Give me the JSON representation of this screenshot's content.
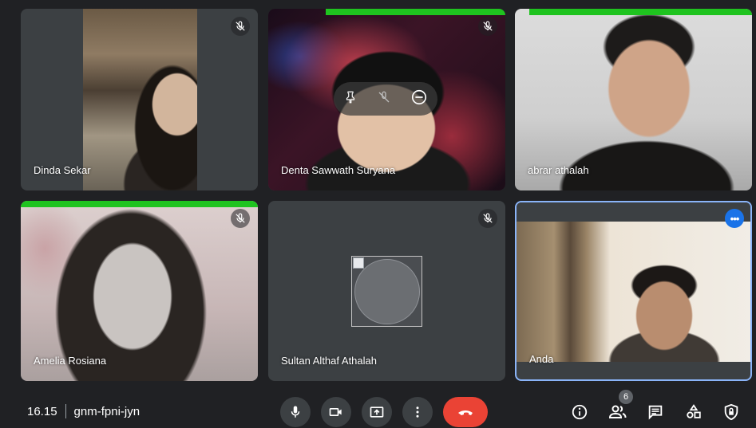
{
  "participants": {
    "dinda": {
      "name": "Dinda Sekar"
    },
    "denta": {
      "name": "Denta Sawwath Suryana"
    },
    "abrar": {
      "name": "abrar athalah"
    },
    "amelia": {
      "name": "Amelia Rosiana"
    },
    "sultan": {
      "name": "Sultan Althaf Athalah"
    },
    "self": {
      "name": "Anda"
    }
  },
  "meeting": {
    "time": "16.15",
    "code": "gnm-fpni-jyn"
  },
  "people_count": "6",
  "colors": {
    "background": "#202124",
    "tile": "#3c4043",
    "speaking": "#1fc31f",
    "self_border": "#8ab4f8",
    "hangup": "#ea4335",
    "accent": "#1a73e8"
  },
  "icons": {
    "mic_off": "mic-off-icon",
    "pin": "pin-icon",
    "remove": "remove-icon",
    "more": "more-options-icon",
    "mic": "mic-icon",
    "camera": "camera-icon",
    "present": "present-screen-icon",
    "more_vert": "more-vert-icon",
    "hangup": "hangup-icon",
    "info": "info-icon",
    "people": "people-icon",
    "chat": "chat-icon",
    "activities": "activities-icon",
    "host_controls": "host-controls-icon"
  }
}
